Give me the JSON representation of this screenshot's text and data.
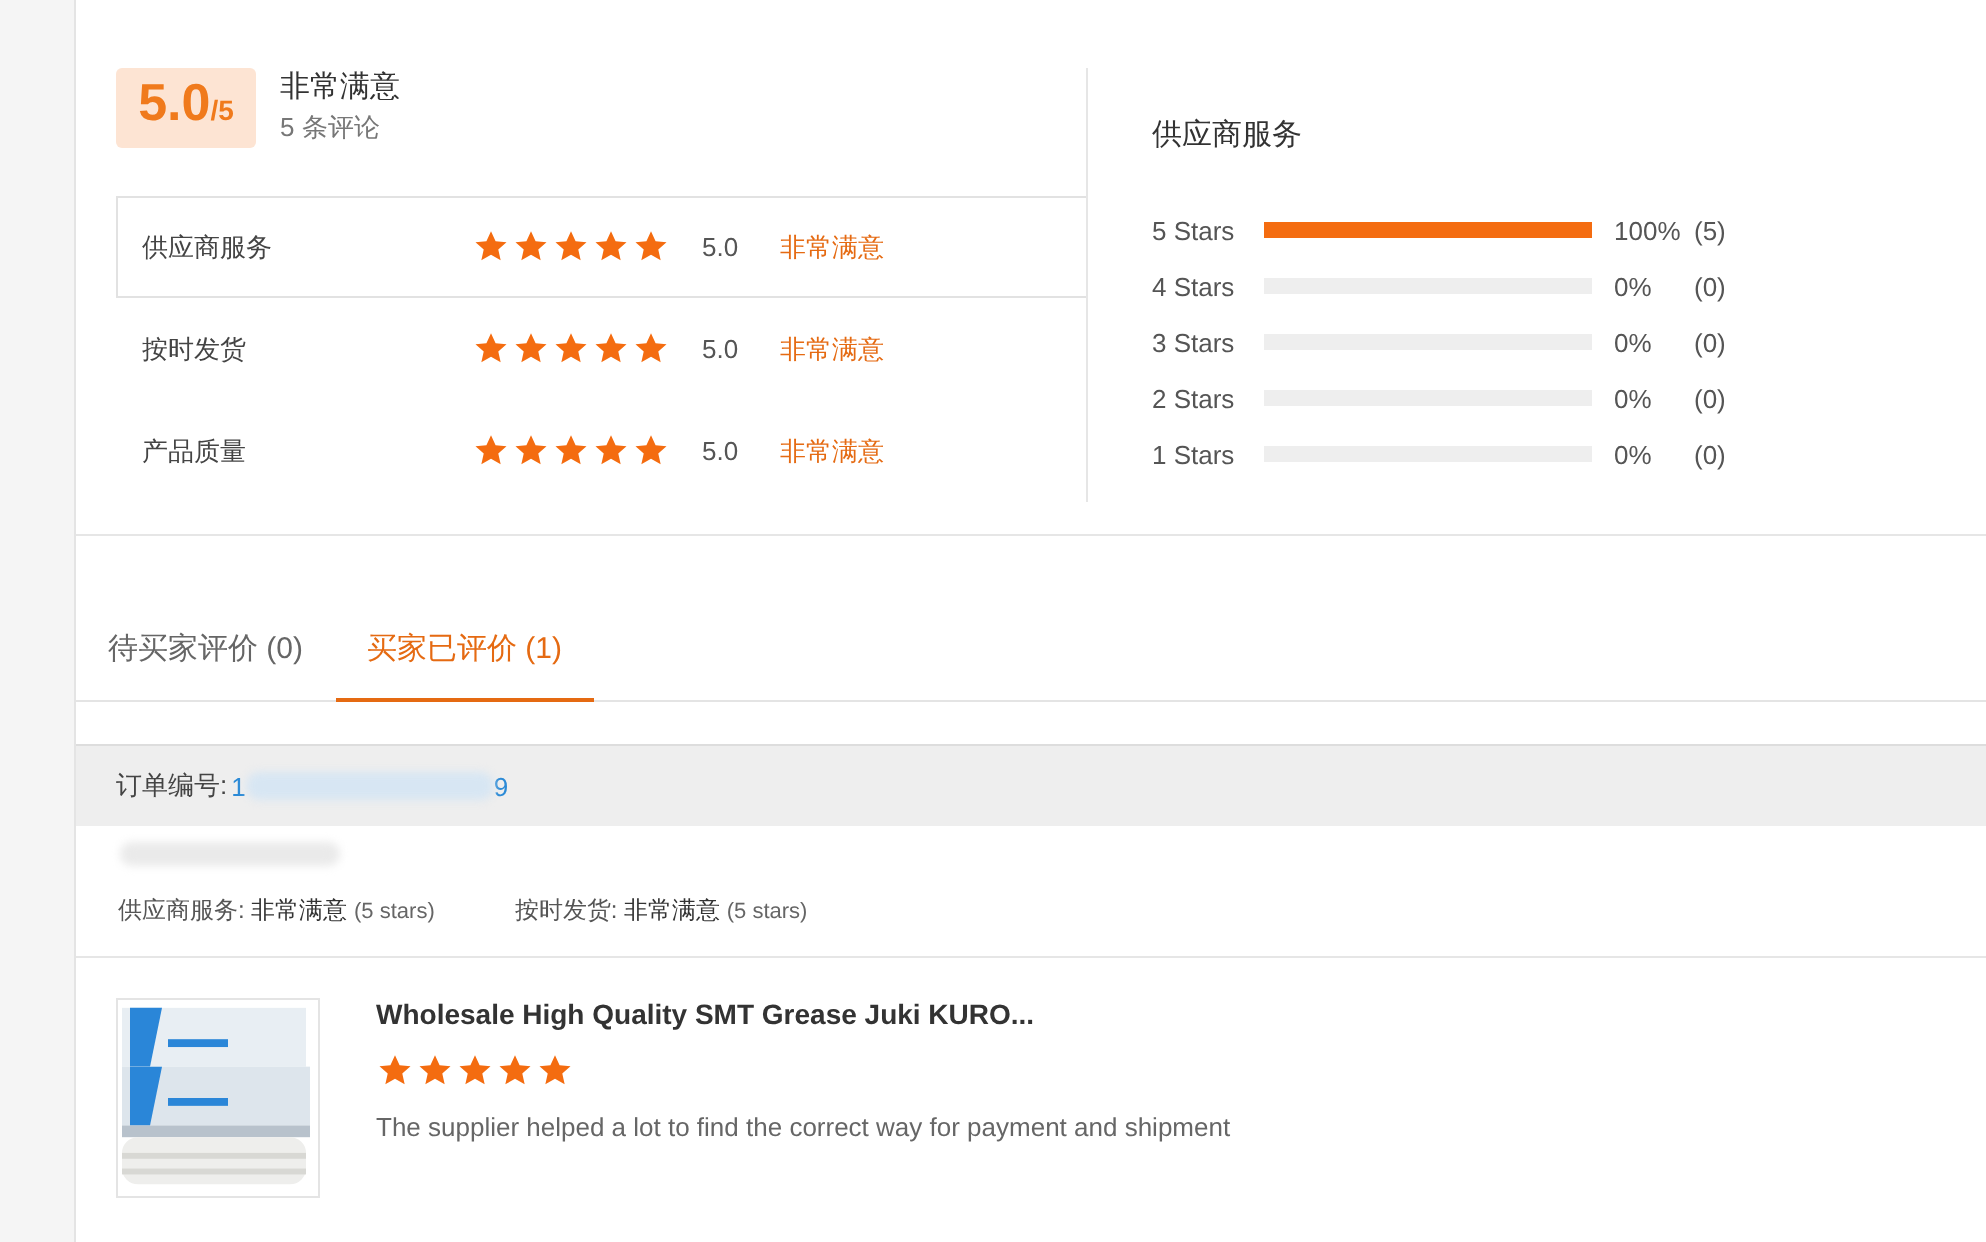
{
  "summary": {
    "score": "5.0",
    "out_of": "/5",
    "verdict": "非常满意",
    "review_count": "5 条评论"
  },
  "ratings": [
    {
      "label": "供应商服务",
      "stars": 5,
      "value": "5.0",
      "verdict": "非常满意",
      "selected": true
    },
    {
      "label": "按时发货",
      "stars": 5,
      "value": "5.0",
      "verdict": "非常满意",
      "selected": false
    },
    {
      "label": "产品质量",
      "stars": 5,
      "value": "5.0",
      "verdict": "非常满意",
      "selected": false
    }
  ],
  "breakdown": {
    "title": "供应商服务",
    "rows": [
      {
        "label": "5 Stars",
        "level": 1,
        "percent": "100%",
        "count": "(5)"
      },
      {
        "label": "4 Stars",
        "level": 0,
        "percent": "0%",
        "count": "(0)"
      },
      {
        "label": "3 Stars",
        "level": 0,
        "percent": "0%",
        "count": "(0)"
      },
      {
        "label": "2 Stars",
        "level": 0,
        "percent": "0%",
        "count": "(0)"
      },
      {
        "label": "1 Stars",
        "level": 0,
        "percent": "0%",
        "count": "(0)"
      }
    ]
  },
  "tabs": [
    {
      "label": "待买家评价 (0)",
      "selected": false
    },
    {
      "label": "买家已评价 (1)",
      "selected": true
    }
  ],
  "order": {
    "label": "订单编号:",
    "number_start": "1",
    "number_end": "9",
    "scores": [
      {
        "label": "供应商服务:",
        "verdict": "非常满意",
        "stars": "(5 stars)"
      },
      {
        "label": "按时发货:",
        "verdict": "非常满意",
        "stars": "(5 stars)"
      }
    ]
  },
  "review": {
    "title": "Wholesale High Quality SMT Grease Juki KURO...",
    "stars": 5,
    "comment": "The supplier helped a lot to find the correct way for payment and shipment"
  }
}
